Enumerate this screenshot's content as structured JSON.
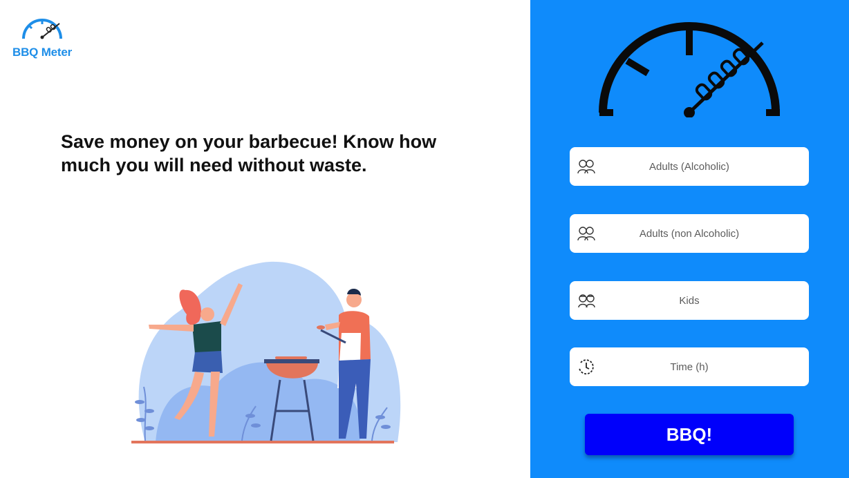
{
  "app": {
    "name": "BBQ Meter"
  },
  "hero": {
    "headline": "Save money on your barbecue! Know how much you will need without waste."
  },
  "form": {
    "fields": [
      {
        "placeholder": "Adults (Alcoholic)",
        "icon": "adults-icon"
      },
      {
        "placeholder": "Adults (non Alcoholic)",
        "icon": "adults-icon"
      },
      {
        "placeholder": "Kids",
        "icon": "kids-icon"
      },
      {
        "placeholder": "Time (h)",
        "icon": "clock-icon"
      }
    ],
    "submit_label": "BBQ!"
  },
  "colors": {
    "panel": "#0f8bfb",
    "button": "#0000fb",
    "logo": "#1e8ee8"
  }
}
